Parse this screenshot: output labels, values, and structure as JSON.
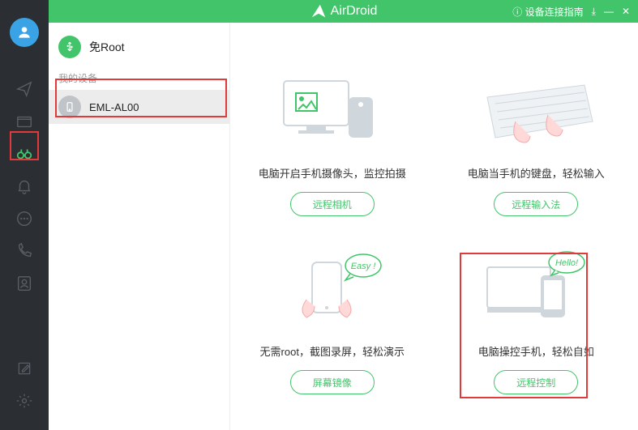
{
  "header": {
    "app_name": "AirDroid",
    "guide_label": "设备连接指南",
    "min_icon": "⤓",
    "restore_icon": "—",
    "close_icon": "✕"
  },
  "sidebar": {
    "usb_label": "免Root",
    "section_label": "我的设备",
    "device_name": "EML-AL00"
  },
  "cards": [
    {
      "desc": "电脑开启手机摄像头，监控拍摄",
      "btn": "远程相机"
    },
    {
      "desc": "电脑当手机的键盘，轻松输入",
      "btn": "远程输入法"
    },
    {
      "desc": "无需root，截图录屏，轻松演示",
      "btn": "屏幕镜像"
    },
    {
      "desc": "电脑操控手机，轻松自如",
      "btn": "远程控制"
    }
  ],
  "bubbles": {
    "easy": "Easy !",
    "hello": "Hello!"
  }
}
